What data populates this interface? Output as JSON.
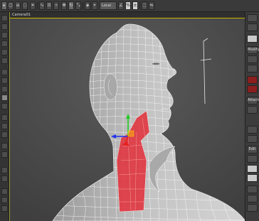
{
  "viewport": {
    "title": "Camera01"
  },
  "toolbar": {
    "view_field": "Local"
  },
  "right_panel": {
    "labels": [
      "Modify",
      "Attach",
      "Edit"
    ]
  },
  "colors": {
    "mesh_fill": "#b7b7b7",
    "wire": "#ffffff",
    "selection": "#e0323c",
    "gizmo_x": "#e52222",
    "gizmo_y": "#22cc22",
    "gizmo_z": "#2233ee",
    "viewport_bg": "#4f4f4f",
    "active_border": "#c8b400"
  }
}
